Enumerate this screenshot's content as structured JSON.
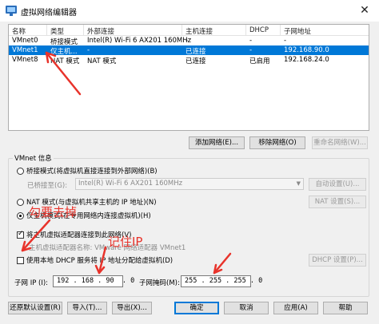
{
  "window": {
    "title": "虚拟网络编辑器",
    "close": "✕"
  },
  "table": {
    "headers": [
      "名称",
      "类型",
      "外部连接",
      "主机连接",
      "DHCP",
      "子网地址"
    ],
    "rows": [
      [
        "VMnet0",
        "桥接模式",
        "Intel(R) Wi-Fi 6 AX201 160MHz",
        "-",
        "-",
        "-"
      ],
      [
        "VMnet1",
        "仅主机...",
        "-",
        "已连接",
        "-",
        "192.168.90.0"
      ],
      [
        "VMnet8",
        "NAT 模式",
        "NAT 模式",
        "已连接",
        "已启用",
        "192.168.24.0"
      ]
    ],
    "selected_index": 1
  },
  "net_buttons": {
    "add": "添加网络(E)...",
    "remove": "移除网络(O)",
    "rename": "重命名网络(W)..."
  },
  "vmnet_info": {
    "title": "VMnet 信息",
    "bridged_label": "桥接模式(将虚拟机直接连接到外部网络)(B)",
    "bridged_to_label": "已桥接至(G):",
    "bridged_to_value": "Intel(R) Wi-Fi 6 AX201 160MHz",
    "auto_settings": "自动设置(U)...",
    "nat_label": "NAT 模式(与虚拟机共享主机的 IP 地址)(N)",
    "nat_settings": "NAT 设置(S)...",
    "hostonly_label": "仅主机模式(在专用网络内连接虚拟机)(H)",
    "selected_mode": "host-only",
    "connect_host_label": "将主机虚拟适配器连接到此网络(V)",
    "connect_host_checked": true,
    "adapter_name_label": "主机虚拟适配器名称: VMware 网络适配器 VMnet1",
    "dhcp_label": "使用本地 DHCP 服务将 IP 地址分配给虚拟机(D)",
    "dhcp_checked": false,
    "dhcp_settings": "DHCP 设置(P)...",
    "subnet_ip_label": "子网 IP (I):",
    "subnet_ip": "192 . 168 . 90  . 0",
    "subnet_mask_label": "子网掩码(M):",
    "subnet_mask": "255 . 255 . 255 . 0"
  },
  "footer_buttons": {
    "restore": "还原默认设置(R)",
    "import": "导入(T)...",
    "export": "导出(X)...",
    "ok": "确定",
    "cancel": "取消",
    "apply": "应用(A)",
    "help": "帮助"
  },
  "annotations": {
    "uncheck": "勾要去掉",
    "note_ip": "记住IP",
    "color": "#e8332b"
  },
  "colors": {
    "selection": "#0078d7",
    "annotation": "#e8332b"
  }
}
